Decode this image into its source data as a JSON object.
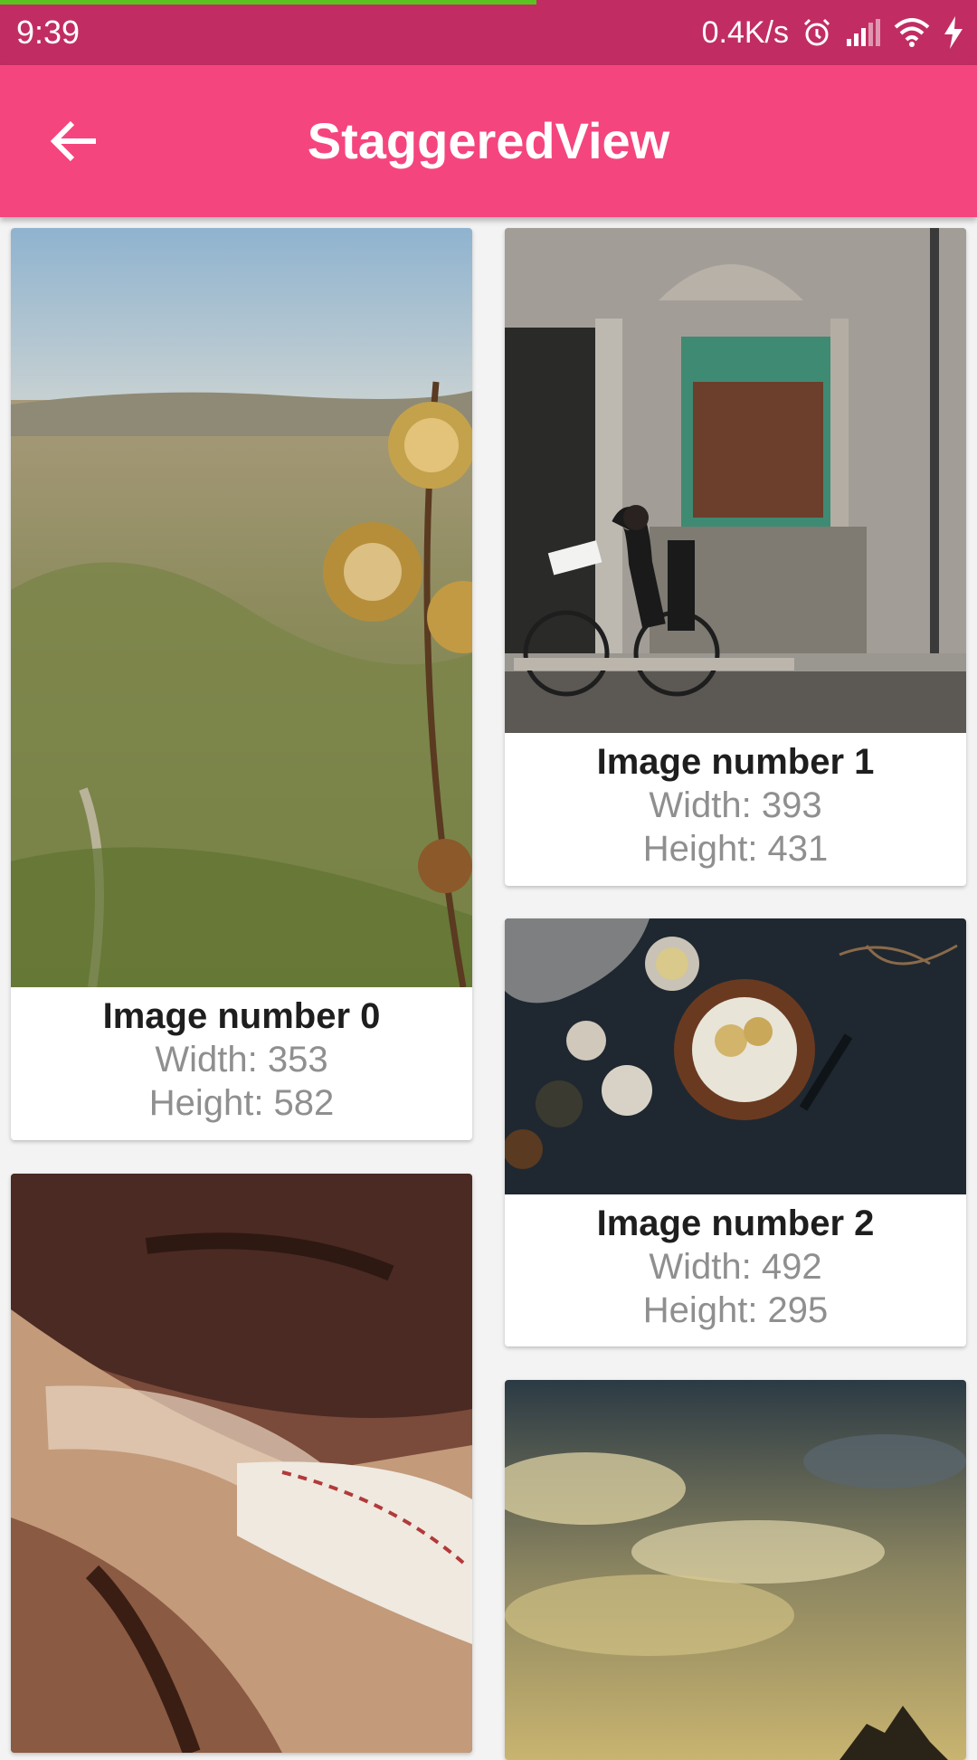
{
  "status_bar": {
    "time": "9:39",
    "net_speed": "0.4K/s",
    "icons": [
      "alarm-icon",
      "signal-icon",
      "wifi-icon",
      "charging-icon"
    ]
  },
  "app_bar": {
    "title": "StaggeredView",
    "back_icon": "arrow-back-icon"
  },
  "colors": {
    "status_bar": "#c12d62",
    "app_bar": "#f5457e",
    "progress": "#59c41f"
  },
  "cards": [
    {
      "title": "Image number 0",
      "width_text": "Width: 353",
      "height_text": "Height: 582",
      "image": "mountain-valley-thistle-photo"
    },
    {
      "title": "Image number 1",
      "width_text": "Width: 393",
      "height_text": "Height: 431",
      "image": "cyclist-old-building-photo"
    },
    {
      "title": "Image number 2",
      "width_text": "Width: 492",
      "height_text": "Height: 295",
      "image": "cake-dark-table-photo"
    },
    {
      "image": "baseball-glove-photo"
    },
    {
      "image": "cloudy-sky-sunset-photo"
    }
  ]
}
